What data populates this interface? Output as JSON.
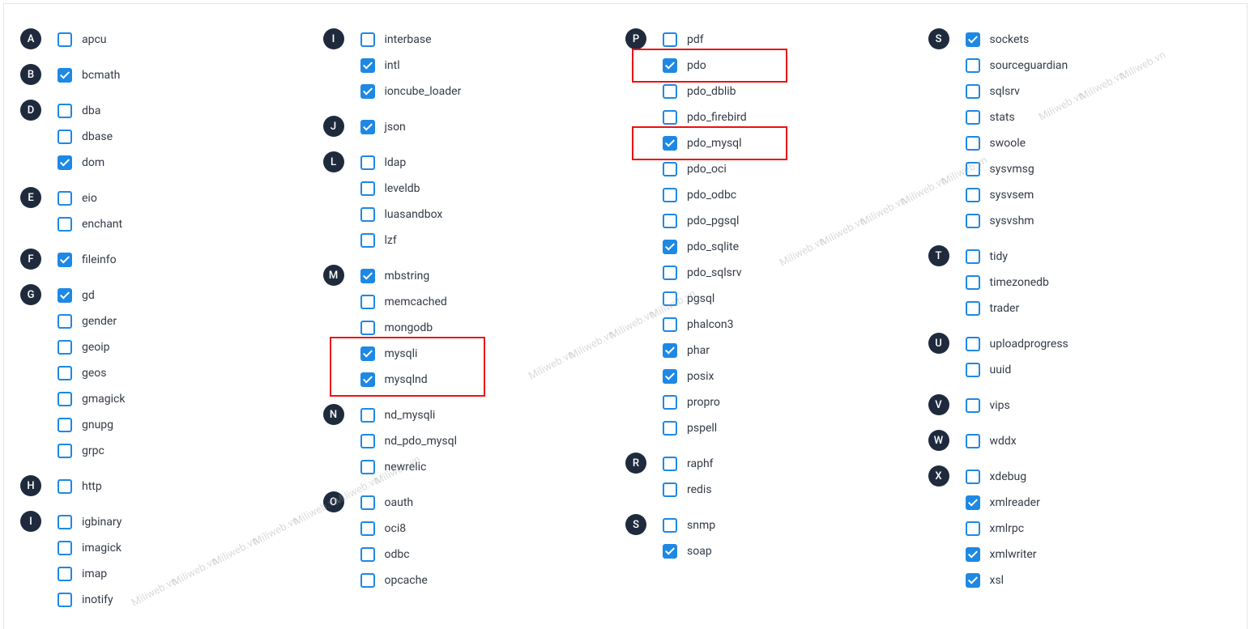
{
  "watermark": "Miliweb.vn",
  "columns": [
    {
      "groups": [
        {
          "letter": "A",
          "items": [
            {
              "label": "apcu",
              "checked": false
            }
          ]
        },
        {
          "letter": "B",
          "items": [
            {
              "label": "bcmath",
              "checked": true
            }
          ]
        },
        {
          "letter": "D",
          "items": [
            {
              "label": "dba",
              "checked": false
            },
            {
              "label": "dbase",
              "checked": false
            },
            {
              "label": "dom",
              "checked": true
            }
          ]
        },
        {
          "letter": "E",
          "items": [
            {
              "label": "eio",
              "checked": false
            },
            {
              "label": "enchant",
              "checked": false
            }
          ]
        },
        {
          "letter": "F",
          "items": [
            {
              "label": "fileinfo",
              "checked": true
            }
          ]
        },
        {
          "letter": "G",
          "items": [
            {
              "label": "gd",
              "checked": true
            },
            {
              "label": "gender",
              "checked": false
            },
            {
              "label": "geoip",
              "checked": false
            },
            {
              "label": "geos",
              "checked": false
            },
            {
              "label": "gmagick",
              "checked": false
            },
            {
              "label": "gnupg",
              "checked": false
            },
            {
              "label": "grpc",
              "checked": false
            }
          ]
        },
        {
          "letter": "H",
          "items": [
            {
              "label": "http",
              "checked": false
            }
          ]
        },
        {
          "letter": "I",
          "items": [
            {
              "label": "igbinary",
              "checked": false
            },
            {
              "label": "imagick",
              "checked": false
            },
            {
              "label": "imap",
              "checked": false
            },
            {
              "label": "inotify",
              "checked": false
            }
          ]
        }
      ]
    },
    {
      "groups": [
        {
          "letter": "I",
          "items": [
            {
              "label": "interbase",
              "checked": false
            },
            {
              "label": "intl",
              "checked": true
            },
            {
              "label": "ioncube_loader",
              "checked": true
            }
          ]
        },
        {
          "letter": "J",
          "items": [
            {
              "label": "json",
              "checked": true
            }
          ]
        },
        {
          "letter": "L",
          "items": [
            {
              "label": "ldap",
              "checked": false
            },
            {
              "label": "leveldb",
              "checked": false
            },
            {
              "label": "luasandbox",
              "checked": false
            },
            {
              "label": "lzf",
              "checked": false
            }
          ]
        },
        {
          "letter": "M",
          "items": [
            {
              "label": "mbstring",
              "checked": true
            },
            {
              "label": "memcached",
              "checked": false
            },
            {
              "label": "mongodb",
              "checked": false
            },
            {
              "label": "mysqli",
              "checked": true,
              "hl": "mysql"
            },
            {
              "label": "mysqlnd",
              "checked": true,
              "hl": "mysql"
            }
          ]
        },
        {
          "letter": "N",
          "items": [
            {
              "label": "nd_mysqli",
              "checked": false
            },
            {
              "label": "nd_pdo_mysql",
              "checked": false
            },
            {
              "label": "newrelic",
              "checked": false
            }
          ]
        },
        {
          "letter": "O",
          "items": [
            {
              "label": "oauth",
              "checked": false
            },
            {
              "label": "oci8",
              "checked": false
            },
            {
              "label": "odbc",
              "checked": false
            },
            {
              "label": "opcache",
              "checked": false
            }
          ]
        }
      ]
    },
    {
      "groups": [
        {
          "letter": "P",
          "items": [
            {
              "label": "pdf",
              "checked": false
            },
            {
              "label": "pdo",
              "checked": true,
              "hl": "pdo"
            },
            {
              "label": "pdo_dblib",
              "checked": false
            },
            {
              "label": "pdo_firebird",
              "checked": false
            },
            {
              "label": "pdo_mysql",
              "checked": true,
              "hl": "pdo_mysql"
            },
            {
              "label": "pdo_oci",
              "checked": false
            },
            {
              "label": "pdo_odbc",
              "checked": false
            },
            {
              "label": "pdo_pgsql",
              "checked": false
            },
            {
              "label": "pdo_sqlite",
              "checked": true
            },
            {
              "label": "pdo_sqlsrv",
              "checked": false
            },
            {
              "label": "pgsql",
              "checked": false
            },
            {
              "label": "phalcon3",
              "checked": false
            },
            {
              "label": "phar",
              "checked": true
            },
            {
              "label": "posix",
              "checked": true
            },
            {
              "label": "propro",
              "checked": false
            },
            {
              "label": "pspell",
              "checked": false
            }
          ]
        },
        {
          "letter": "R",
          "items": [
            {
              "label": "raphf",
              "checked": false
            },
            {
              "label": "redis",
              "checked": false
            }
          ]
        },
        {
          "letter": "S",
          "items": [
            {
              "label": "snmp",
              "checked": false
            },
            {
              "label": "soap",
              "checked": true
            }
          ]
        }
      ]
    },
    {
      "groups": [
        {
          "letter": "S",
          "items": [
            {
              "label": "sockets",
              "checked": true
            },
            {
              "label": "sourceguardian",
              "checked": false
            },
            {
              "label": "sqlsrv",
              "checked": false
            },
            {
              "label": "stats",
              "checked": false
            },
            {
              "label": "swoole",
              "checked": false
            },
            {
              "label": "sysvmsg",
              "checked": false
            },
            {
              "label": "sysvsem",
              "checked": false
            },
            {
              "label": "sysvshm",
              "checked": false
            }
          ]
        },
        {
          "letter": "T",
          "items": [
            {
              "label": "tidy",
              "checked": false
            },
            {
              "label": "timezonedb",
              "checked": false
            },
            {
              "label": "trader",
              "checked": false
            }
          ]
        },
        {
          "letter": "U",
          "items": [
            {
              "label": "uploadprogress",
              "checked": false
            },
            {
              "label": "uuid",
              "checked": false
            }
          ]
        },
        {
          "letter": "V",
          "items": [
            {
              "label": "vips",
              "checked": false
            }
          ]
        },
        {
          "letter": "W",
          "items": [
            {
              "label": "wddx",
              "checked": false
            }
          ]
        },
        {
          "letter": "X",
          "items": [
            {
              "label": "xdebug",
              "checked": false
            },
            {
              "label": "xmlreader",
              "checked": true
            },
            {
              "label": "xmlrpc",
              "checked": false
            },
            {
              "label": "xmlwriter",
              "checked": true
            },
            {
              "label": "xsl",
              "checked": true
            }
          ]
        }
      ]
    }
  ],
  "highlights": {
    "pdo": true,
    "pdo_mysql": true,
    "mysql": true
  }
}
